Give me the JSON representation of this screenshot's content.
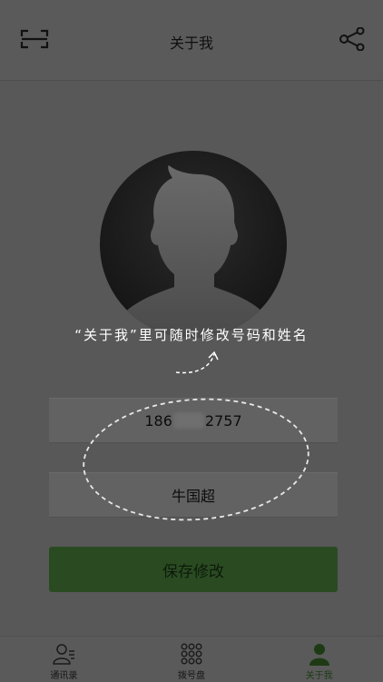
{
  "header": {
    "title": "关于我",
    "left_icon": "scan-icon",
    "right_icon": "share-icon"
  },
  "avatar": {
    "icon": "person-silhouette-icon"
  },
  "hint": {
    "text": "“关于我”里可随时修改号码和姓名"
  },
  "form": {
    "phone_prefix": "186",
    "phone_suffix": "2757",
    "name": "牛国超"
  },
  "save_button": {
    "label": "保存修改"
  },
  "tabbar": {
    "tabs": [
      {
        "label": "通讯录",
        "icon": "contacts-icon",
        "active": false
      },
      {
        "label": "拨号盘",
        "icon": "dialpad-icon",
        "active": false
      },
      {
        "label": "关于我",
        "icon": "person-icon",
        "active": true
      }
    ]
  },
  "colors": {
    "overlay_background": "#585858",
    "accent_green": "#2a4b22",
    "active_tab": "#1d3a15"
  }
}
